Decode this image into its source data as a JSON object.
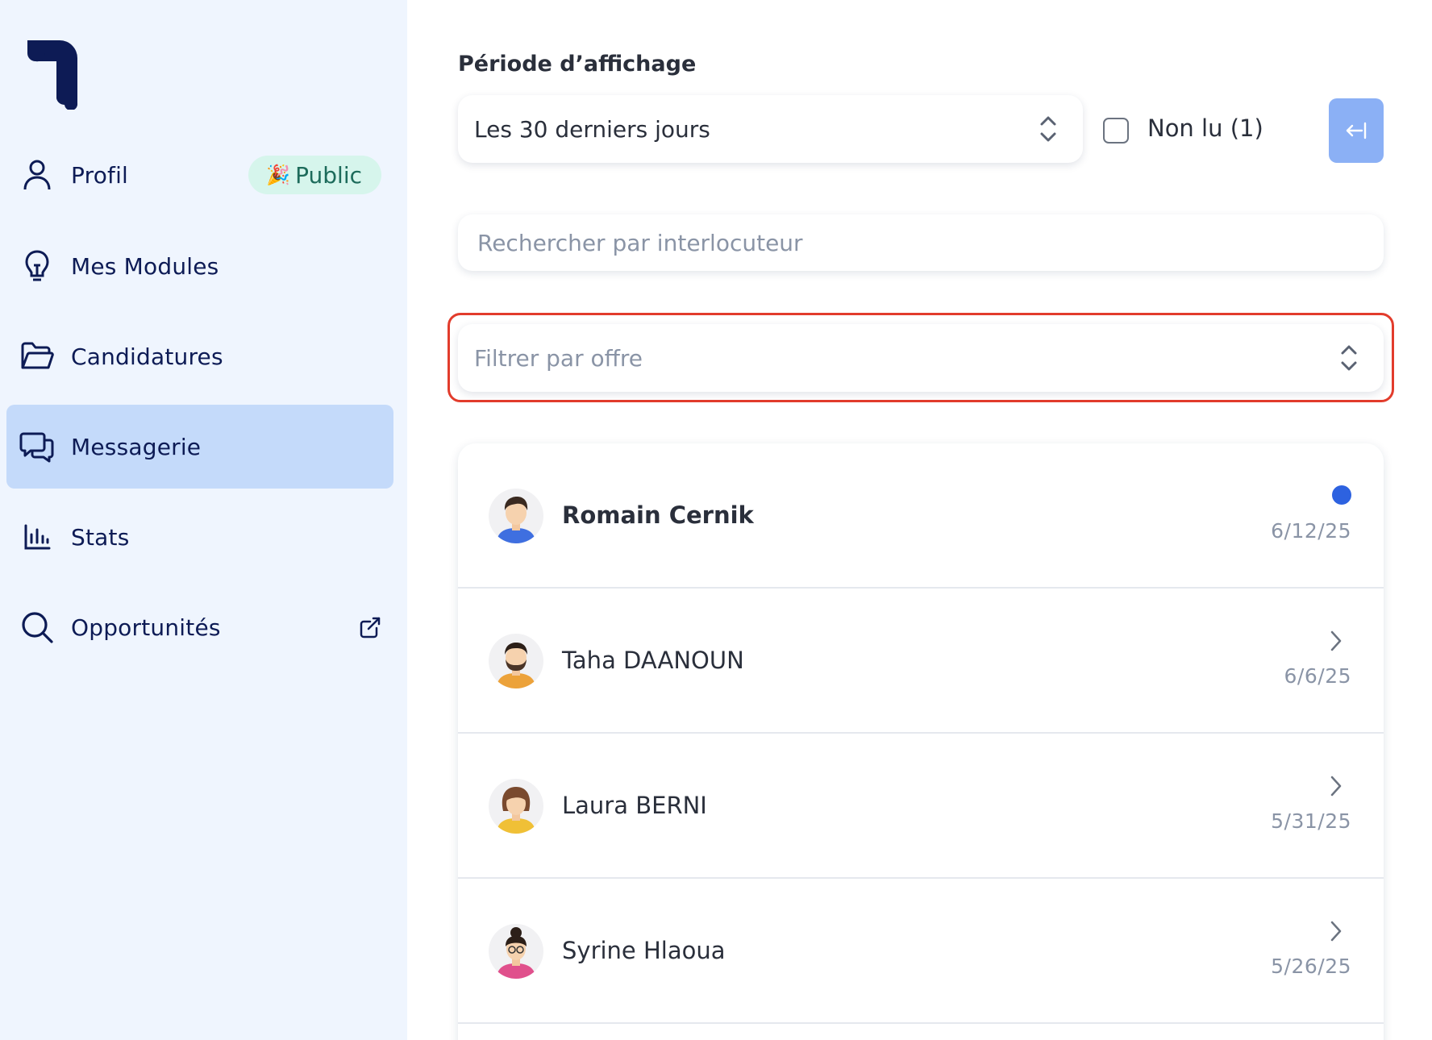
{
  "sidebar": {
    "items": [
      {
        "label": "Profil",
        "icon": "user-icon"
      },
      {
        "label": "Mes Modules",
        "icon": "lightbulb-icon"
      },
      {
        "label": "Candidatures",
        "icon": "folder-icon"
      },
      {
        "label": "Messagerie",
        "icon": "chat-icon",
        "active": true
      },
      {
        "label": "Stats",
        "icon": "bar-chart-icon"
      },
      {
        "label": "Opportunités",
        "icon": "search-icon"
      }
    ],
    "badge": {
      "emoji": "🎉",
      "label": "Public"
    }
  },
  "filters": {
    "period_label": "Période d’affichage",
    "period_value": "Les 30 derniers jours",
    "unread_label": "Non lu (1)",
    "search_placeholder": "Rechercher par interlocuteur",
    "offer_placeholder": "Filtrer par offre"
  },
  "conversations": [
    {
      "name": "Romain Cernik",
      "date": "6/12/25",
      "unread": true
    },
    {
      "name": "Taha DAANOUN",
      "date": "6/6/25",
      "unread": false
    },
    {
      "name": "Laura BERNI",
      "date": "5/31/25",
      "unread": false
    },
    {
      "name": "Syrine Hlaoua",
      "date": "5/26/25",
      "unread": false
    }
  ],
  "colors": {
    "sidebar_bg": "#eff5fe",
    "active_nav_bg": "#c4dafa",
    "navy": "#0d1b55",
    "highlight_border": "#e23c2c",
    "unread_dot": "#2d62e0",
    "collapse_button": "#8bb0f5",
    "badge_bg": "#d6f5ec"
  }
}
